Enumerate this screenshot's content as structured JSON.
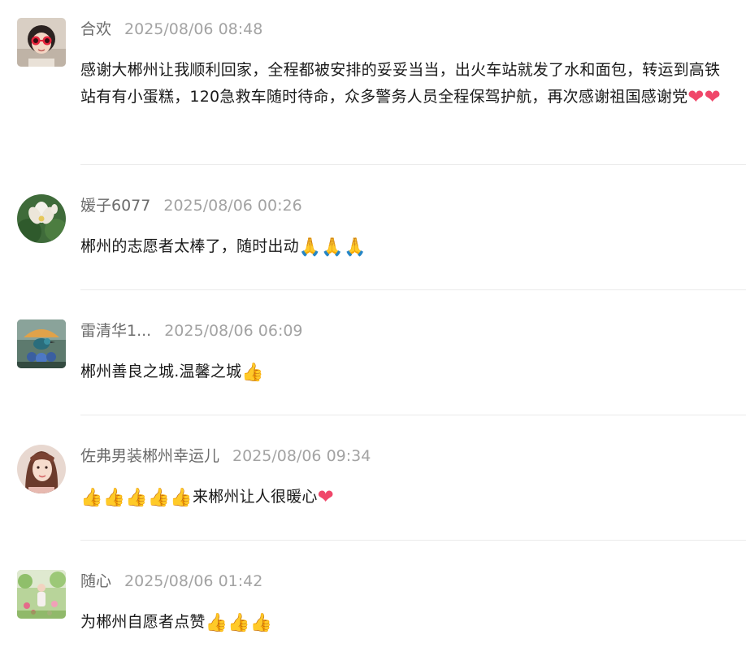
{
  "comments": [
    {
      "name": "合欢",
      "time": "2025/08/06 08:48",
      "text": "感谢大郴州让我顺利回家，全程都被安排的妥妥当当，出火车站就发了水和面包，转运到高铁站有有小蛋糕，120急救车随时待命，众多警务人员全程保驾护航，再次感谢祖国感谢党",
      "emojis": [
        "❤",
        "❤"
      ],
      "avatar_icon": "girl-sunglasses-avatar"
    },
    {
      "name": "媛子6077",
      "time": "2025/08/06 00:26",
      "text": "郴州的志愿者太棒了，随时出动",
      "emojis": [
        "🙏",
        "🙏",
        "🙏"
      ],
      "avatar_icon": "lotus-avatar"
    },
    {
      "name": "雷清华1...",
      "time": "2025/08/06 06:09",
      "text": "郴州善良之城.温馨之城",
      "emojis": [
        "👍"
      ],
      "avatar_icon": "bird-avatar"
    },
    {
      "name": "佐弗男装郴州幸运儿",
      "time": "2025/08/06 09:34",
      "text_before": "",
      "emojis_before": [
        "👍",
        "👍",
        "👍",
        "👍",
        "👍"
      ],
      "text": "来郴州让人很暖心",
      "emojis": [
        "❤"
      ],
      "avatar_icon": "woman-portrait-avatar"
    },
    {
      "name": "随心",
      "time": "2025/08/06 01:42",
      "text": "为郴州自愿者点赞",
      "emojis": [
        "👍",
        "👍",
        "👍"
      ],
      "avatar_icon": "garden-photo-avatar"
    }
  ]
}
